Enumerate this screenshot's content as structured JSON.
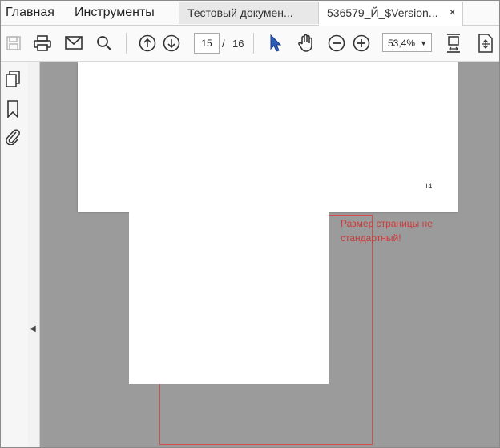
{
  "menu": {
    "home": "Главная",
    "tools": "Инструменты"
  },
  "tabs": [
    {
      "label": "Тестовый докумен..."
    },
    {
      "label": "536579_Й_$Version...",
      "close": "×"
    }
  ],
  "toolbar": {
    "page_current": "15",
    "page_separator": "/",
    "page_total": "16",
    "zoom": "53,4%",
    "zoom_caret": "▼"
  },
  "document": {
    "page_number": "14",
    "warning": "Размер страницы не стандартный!"
  },
  "colors": {
    "warning": "#d03a3a",
    "accent_cursor": "#2d5bb8",
    "canvas": "#9b9b9b"
  }
}
